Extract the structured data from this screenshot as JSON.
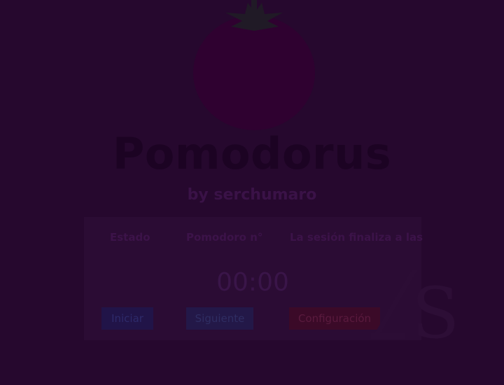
{
  "app": {
    "title": "Pomodorus",
    "subtitle": "by serchumaro"
  },
  "logo": {
    "icon": "tomato-icon"
  },
  "panel": {
    "status_label": "Estado",
    "pomodoro_number_label": "Pomodoro n°",
    "session_end_label": "La sesión finaliza a las"
  },
  "timer": {
    "value": "00:00"
  },
  "buttons": {
    "start_label": "Iniciar",
    "next_label": "Siguiente",
    "config_label": "Configuración"
  },
  "watermark": {
    "icon": "watermark-logo-icon",
    "text": "S"
  },
  "colors": {
    "background": "#26082e",
    "tomato": "#2f0130",
    "panel": "#2b0c34",
    "start_button": "#211448",
    "next_button": "#231848",
    "config_button": "#3b0a28"
  }
}
